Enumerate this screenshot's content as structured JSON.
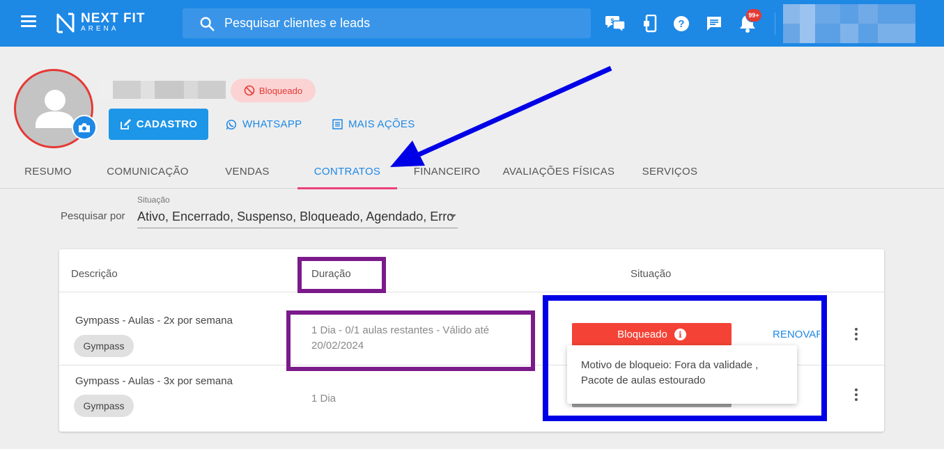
{
  "topbar": {
    "logo_line1": "NEXT FIT",
    "logo_line2": "ARENA",
    "search_placeholder": "Pesquisar clientes e leads",
    "notifications_badge": "99+",
    "icons": [
      "menu-icon",
      "chat-money-icon",
      "mobile-icon",
      "help-icon",
      "message-icon",
      "bell-icon"
    ]
  },
  "profile": {
    "status_chip": "Bloqueado",
    "buttons": {
      "cadastro": "CADASTRO",
      "whatsapp": "WHATSAPP",
      "mais_acoes": "MAIS AÇÕES"
    }
  },
  "tabs": [
    "RESUMO",
    "COMUNICAÇÃO",
    "VENDAS",
    "CONTRATOS",
    "FINANCEIRO",
    "AVALIAÇÕES FÍSICAS",
    "SERVIÇOS"
  ],
  "active_tab": "CONTRATOS",
  "filter": {
    "label": "Pesquisar por",
    "caption": "Situação",
    "value": "Ativo, Encerrado, Suspenso, Bloqueado, Agendado, Erro"
  },
  "table": {
    "headers": [
      "Descrição",
      "Duração",
      "Situação"
    ],
    "rows": [
      {
        "description": "Gympass - Aulas - 2x por semana",
        "tag": "Gympass",
        "duration": "1 Dia - 0/1 aulas restantes - Válido até 20/02/2024",
        "status": "Bloqueado",
        "action": "RENOVAR"
      },
      {
        "description": "Gympass - Aulas - 3x por semana",
        "tag": "Gympass",
        "duration": "1 Dia"
      }
    ],
    "tooltip": "Motivo de bloqueio: Fora da validade , Pacote de aulas estourado"
  },
  "colors": {
    "primary": "#1e88e5",
    "danger": "#f44336",
    "tab_indicator": "#ec407a",
    "annotation_purple": "#7b1a8a",
    "annotation_blue": "#0000e6"
  }
}
